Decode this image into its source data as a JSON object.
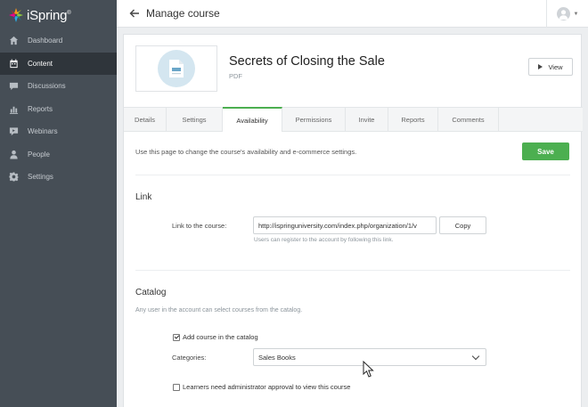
{
  "app": {
    "name": "iSpring",
    "reg": "®"
  },
  "nav": [
    {
      "label": "Dashboard",
      "icon": "home-icon",
      "active": false
    },
    {
      "label": "Content",
      "icon": "calendar-icon",
      "active": true
    },
    {
      "label": "Discussions",
      "icon": "chat-icon",
      "active": false
    },
    {
      "label": "Reports",
      "icon": "bar-chart-icon",
      "active": false
    },
    {
      "label": "Webinars",
      "icon": "webinar-icon",
      "active": false
    },
    {
      "label": "People",
      "icon": "person-icon",
      "active": false
    },
    {
      "label": "Settings",
      "icon": "gear-icon",
      "active": false
    }
  ],
  "topbar": {
    "title": "Manage course"
  },
  "course": {
    "title": "Secrets of Closing the Sale",
    "type": "PDF",
    "view_label": "View"
  },
  "tabs": [
    {
      "label": "Details",
      "active": false
    },
    {
      "label": "Settings",
      "active": false
    },
    {
      "label": "Availability",
      "active": true
    },
    {
      "label": "Permissions",
      "active": false
    },
    {
      "label": "Invite",
      "active": false
    },
    {
      "label": "Reports",
      "active": false
    },
    {
      "label": "Comments",
      "active": false
    }
  ],
  "availability": {
    "description": "Use this page to change the course's availability and e-commerce settings.",
    "save_label": "Save"
  },
  "link": {
    "section_title": "Link",
    "field_label": "Link to the course:",
    "url": "http://ispringuniversity.com/index.php/organization/1/v",
    "copy_label": "Copy",
    "hint": "Users can register to the account by following this link."
  },
  "catalog": {
    "section_title": "Catalog",
    "description": "Any user in the account can select courses from the catalog.",
    "add_label": "Add course in the catalog",
    "add_checked": true,
    "categories_label": "Categories:",
    "categories_value": "Sales Books",
    "approval_label": "Learners need administrator approval to view this course",
    "approval_checked": false
  },
  "colors": {
    "sidebar": "#464e56",
    "sidebar_active": "#2f353b",
    "accent": "#4caf50"
  }
}
